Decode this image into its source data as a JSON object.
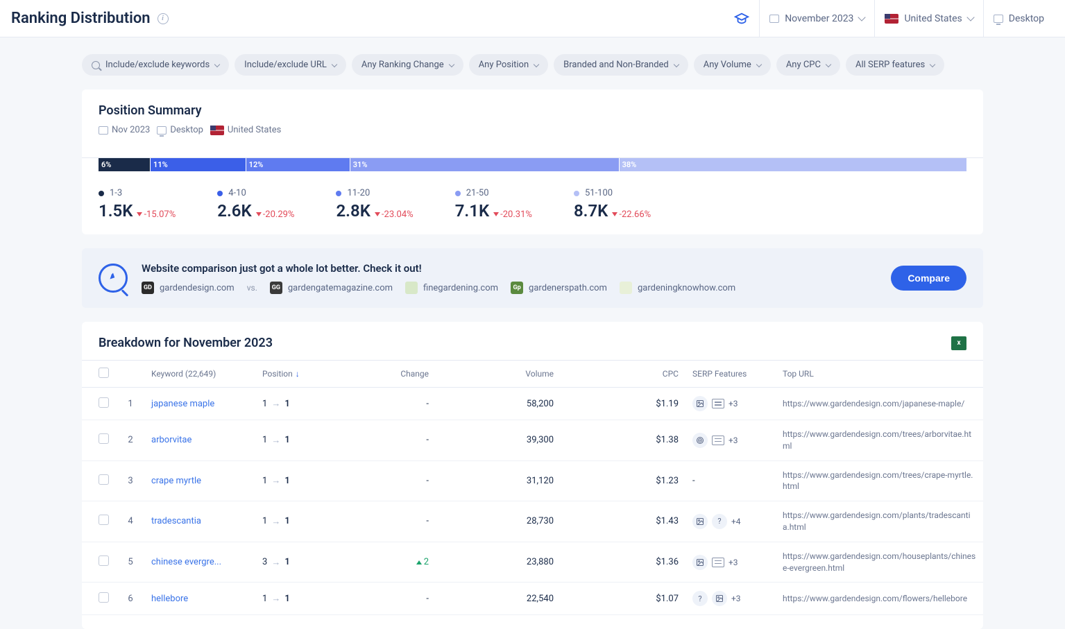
{
  "header": {
    "title": "Ranking Distribution",
    "date": "November 2023",
    "country": "United States",
    "device": "Desktop"
  },
  "filters": [
    "Include/exclude keywords",
    "Include/exclude URL",
    "Any Ranking Change",
    "Any Position",
    "Branded and Non-Branded",
    "Any Volume",
    "Any CPC",
    "All SERP features"
  ],
  "summary": {
    "title": "Position Summary",
    "meta": {
      "date": "Nov 2023",
      "device": "Desktop",
      "country": "United States"
    },
    "segments": [
      {
        "label": "6%",
        "pct": 6,
        "color": "#1a2b49"
      },
      {
        "label": "11%",
        "pct": 11,
        "color": "#3b5fe8"
      },
      {
        "label": "12%",
        "pct": 12,
        "color": "#5f7bf0"
      },
      {
        "label": "31%",
        "pct": 31,
        "color": "#8a9cf3"
      },
      {
        "label": "38%",
        "pct": 40,
        "color": "#b4c0f6"
      }
    ],
    "buckets": [
      {
        "range": "1-3",
        "value": "1.5K",
        "change": "-15.07%",
        "color": "#1a2b49"
      },
      {
        "range": "4-10",
        "value": "2.6K",
        "change": "-20.29%",
        "color": "#3b5fe8"
      },
      {
        "range": "11-20",
        "value": "2.8K",
        "change": "-23.04%",
        "color": "#5f7bf0"
      },
      {
        "range": "21-50",
        "value": "7.1K",
        "change": "-20.31%",
        "color": "#8a9cf3"
      },
      {
        "range": "51-100",
        "value": "8.7K",
        "change": "-22.66%",
        "color": "#b4c0f6"
      }
    ]
  },
  "compare": {
    "title": "Website comparison just got a whole lot better. Check it out!",
    "button": "Compare",
    "vs": "vs.",
    "sites": [
      {
        "domain": "gardendesign.com",
        "favbg": "#2b2b2b",
        "favtxt": "GD"
      },
      {
        "domain": "gardengatemagazine.com",
        "favbg": "#3a3a3a",
        "favtxt": "GG"
      },
      {
        "domain": "finegardening.com",
        "favbg": "#d8e8c8",
        "favtxt": ""
      },
      {
        "domain": "gardenerspath.com",
        "favbg": "#5b8a3f",
        "favtxt": "Gp"
      },
      {
        "domain": "gardeningknowhow.com",
        "favbg": "#e8f0d8",
        "favtxt": ""
      }
    ]
  },
  "breakdown": {
    "title": "Breakdown for November 2023",
    "keyword_count": "22,649",
    "columns": {
      "keyword": "Keyword",
      "position": "Position",
      "change": "Change",
      "volume": "Volume",
      "cpc": "CPC",
      "serp": "SERP Features",
      "url": "Top URL"
    },
    "rows": [
      {
        "n": "1",
        "keyword": "japanese maple",
        "pos_from": "1",
        "pos_to": "1",
        "change": "-",
        "volume": "58,200",
        "cpc": "$1.19",
        "serp_extra": "+3",
        "serp_icons": [
          "img",
          "book"
        ],
        "url": "https://www.gardendesign.com/japanese-maple/"
      },
      {
        "n": "2",
        "keyword": "arborvitae",
        "pos_from": "1",
        "pos_to": "1",
        "change": "-",
        "volume": "39,300",
        "cpc": "$1.38",
        "serp_extra": "+3",
        "serp_icons": [
          "target",
          "book"
        ],
        "url": "https://www.gardendesign.com/trees/arborvitae.html"
      },
      {
        "n": "3",
        "keyword": "crape myrtle",
        "pos_from": "1",
        "pos_to": "1",
        "change": "-",
        "volume": "31,120",
        "cpc": "$1.23",
        "serp_extra": "-",
        "serp_icons": [],
        "url": "https://www.gardendesign.com/trees/crape-myrtle.html"
      },
      {
        "n": "4",
        "keyword": "tradescantia",
        "pos_from": "1",
        "pos_to": "1",
        "change": "-",
        "volume": "28,730",
        "cpc": "$1.43",
        "serp_extra": "+4",
        "serp_icons": [
          "img",
          "question"
        ],
        "url": "https://www.gardendesign.com/plants/tradescantia.html"
      },
      {
        "n": "5",
        "keyword": "chinese evergre...",
        "pos_from": "3",
        "pos_to": "1",
        "change": "2",
        "change_dir": "up",
        "volume": "23,880",
        "cpc": "$1.36",
        "serp_extra": "+3",
        "serp_icons": [
          "img",
          "book"
        ],
        "url": "https://www.gardendesign.com/houseplants/chinese-evergreen.html"
      },
      {
        "n": "6",
        "keyword": "hellebore",
        "pos_from": "1",
        "pos_to": "1",
        "change": "-",
        "volume": "22,540",
        "cpc": "$1.07",
        "serp_extra": "+3",
        "serp_icons": [
          "question",
          "img"
        ],
        "url": "https://www.gardendesign.com/flowers/hellebore"
      }
    ]
  }
}
